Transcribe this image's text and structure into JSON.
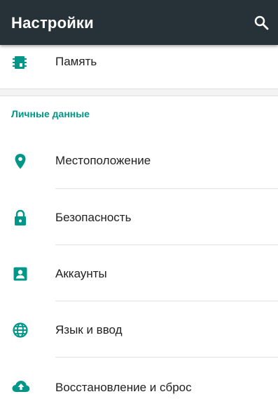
{
  "appbar": {
    "title": "Настройки",
    "search_icon": "search-icon",
    "color": "#263238"
  },
  "accent_color": "#009688",
  "top_item": {
    "label": "Память",
    "icon": "memory-icon"
  },
  "section": {
    "title": "Личные данные",
    "items": [
      {
        "label": "Местоположение",
        "icon": "location-icon"
      },
      {
        "label": "Безопасность",
        "icon": "lock-icon"
      },
      {
        "label": "Аккаунты",
        "icon": "account-icon"
      },
      {
        "label": "Язык и ввод",
        "icon": "globe-icon"
      },
      {
        "label": "Восстановление и сброс",
        "icon": "cloud-upload-icon"
      }
    ]
  }
}
